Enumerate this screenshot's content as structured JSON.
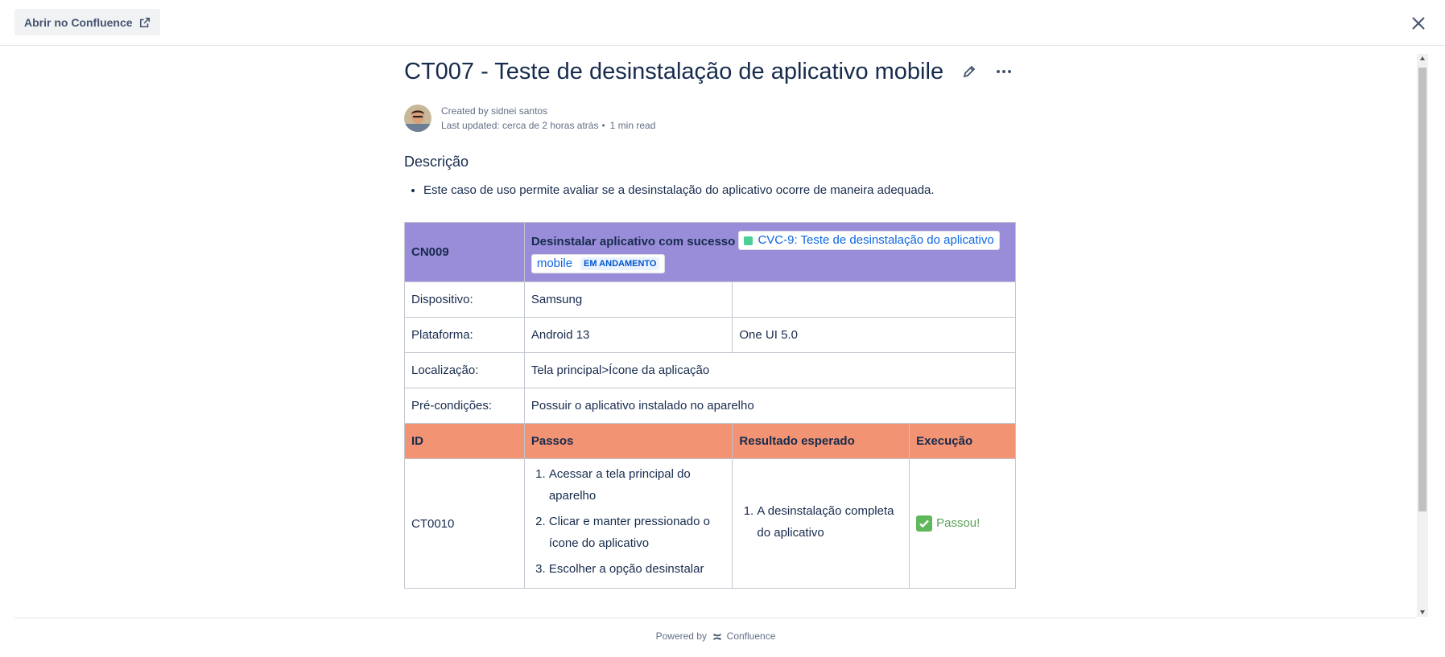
{
  "topbar": {
    "open_label": "Abrir no Confluence"
  },
  "page": {
    "title": "CT007 - Teste de desinstalação de aplicativo mobile",
    "created_by": "Created by sidnei santos",
    "last_updated": "Last updated: cerca de 2 horas atrás",
    "dot": "•",
    "read_time": "1 min read"
  },
  "description": {
    "heading": "Descrição",
    "bullets": [
      "Este caso de uso permite avaliar se a desinstalação do aplicativo ocorre de maneira adequada."
    ]
  },
  "table": {
    "head_id": "CN009",
    "head_title": "Desinstalar aplicativo com sucesso",
    "jira_link_text_1": "CVC-9: Teste de desinstalação do aplicativo",
    "jira_link_text_2": "mobile",
    "jira_status": "EM ANDAMENTO",
    "rows": [
      {
        "label": "Dispositivo:",
        "value": "Samsung",
        "extra": ""
      },
      {
        "label": "Plataforma:",
        "value": "Android 13",
        "extra": "One UI 5.0"
      },
      {
        "label": "Localização:",
        "value": "Tela principal>Ícone da aplicação"
      },
      {
        "label": "Pré-condições:",
        "value": "Possuir o aplicativo instalado no aparelho"
      }
    ],
    "steps_header": [
      "ID",
      "Passos",
      "Resultado esperado",
      "Execução"
    ],
    "step_row": {
      "id": "CT0010",
      "steps": [
        "Acessar a tela principal do aparelho",
        "Clicar e manter pressionado o ícone do aplicativo",
        "Escolher a opção desinstalar"
      ],
      "expected": [
        "A desinstalação completa do aplicativo"
      ],
      "execution": "Passou!"
    }
  },
  "footer": {
    "powered_by": "Powered by",
    "brand": "Confluence"
  },
  "colors": {
    "head_row": "#998dd9",
    "steps_header_row": "#f29373",
    "status_lozenge": "#e9f2ff",
    "link": "#0c66e4",
    "passed": "#5e9f59"
  }
}
